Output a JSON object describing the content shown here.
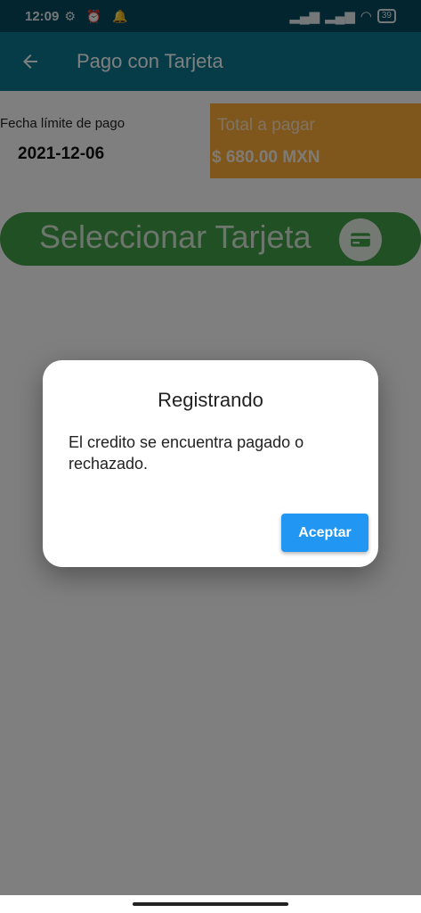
{
  "status_bar": {
    "time": "12:09",
    "battery": "39"
  },
  "app_bar": {
    "title": "Pago con Tarjeta",
    "back_icon": "arrow-left-icon"
  },
  "payment": {
    "due_label": "Fecha límite de pago",
    "due_date": "2021-12-06",
    "total_label": "Total a pagar",
    "total_amount": "$ 680.00 MXN"
  },
  "select_card": {
    "label": "Seleccionar Tarjeta",
    "icon": "credit-card-icon"
  },
  "dialog": {
    "title": "Registrando",
    "message": "El credito se encuentra pagado o rechazado.",
    "accept_label": "Aceptar"
  },
  "colors": {
    "status_bar": "#054a5e",
    "app_bar": "#0a7891",
    "total_box": "#ffae3a",
    "select_button": "#43a048",
    "accept_button": "#2196f3"
  }
}
